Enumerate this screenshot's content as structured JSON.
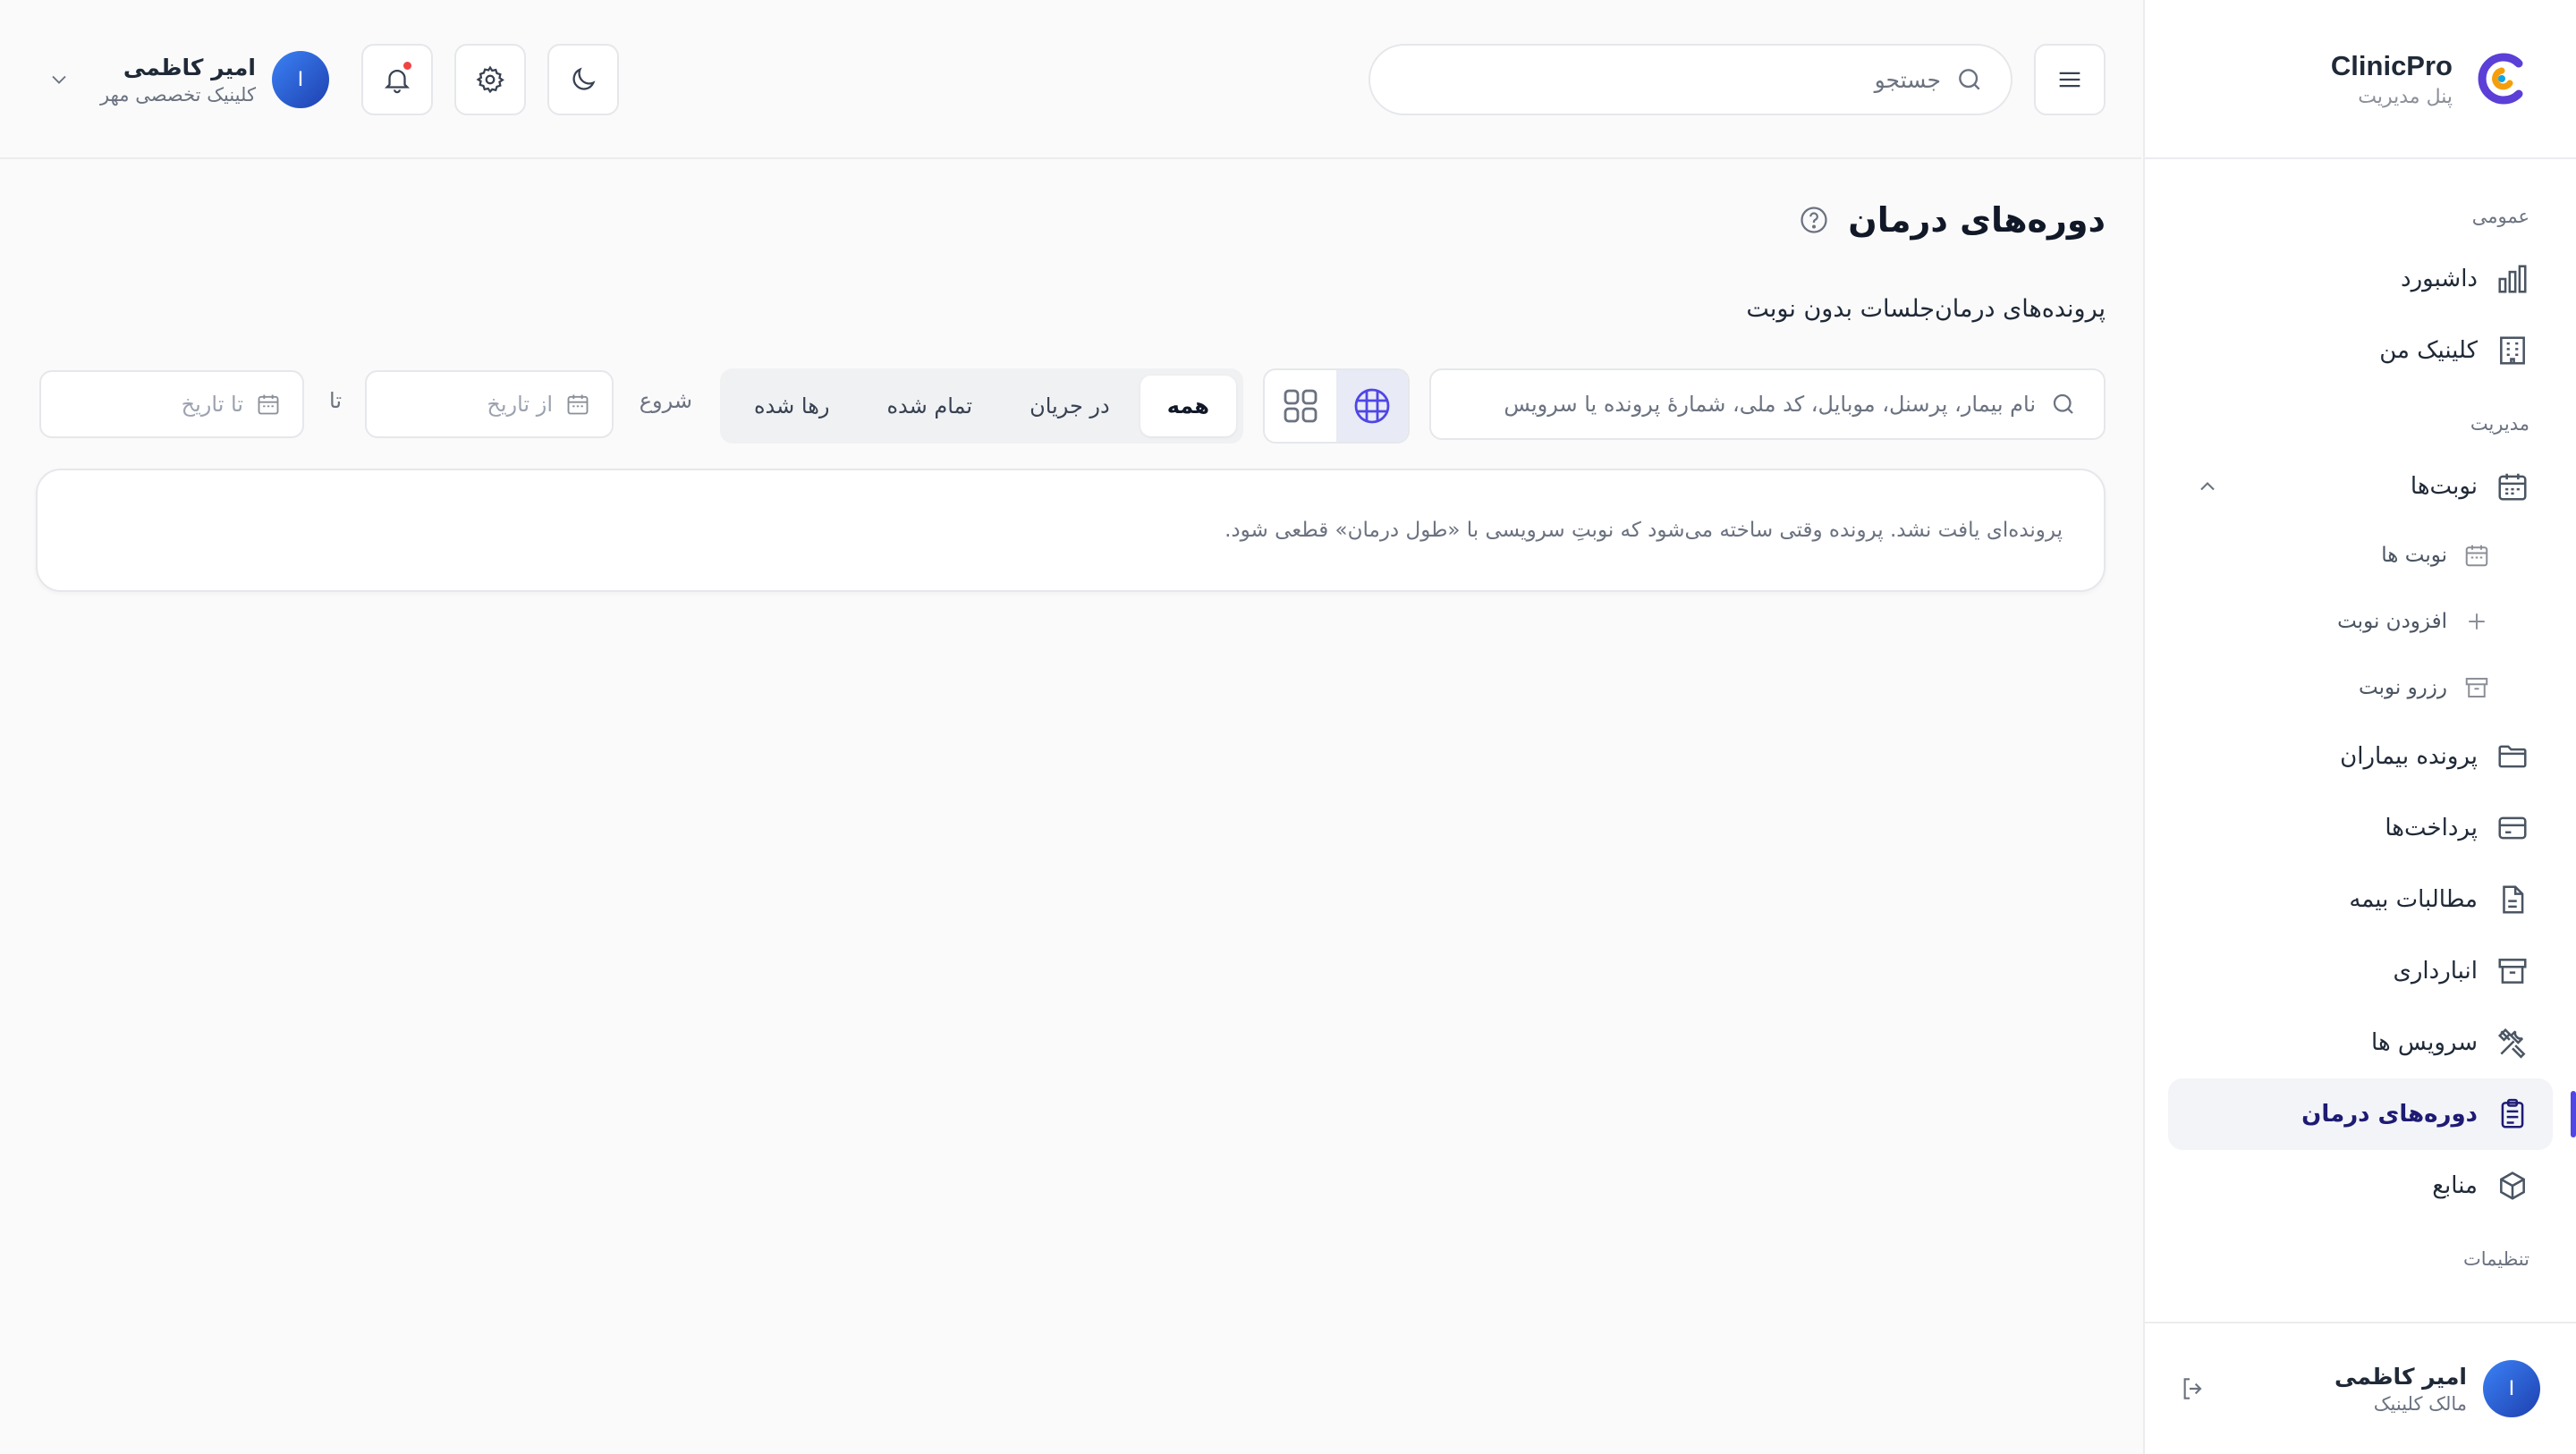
{
  "brand": {
    "name": "ClinicPro",
    "subtitle": "پنل مدیریت"
  },
  "sidebar": {
    "section_general": "عمومی",
    "section_management": "مدیریت",
    "section_settings": "تنظیمات",
    "dashboard": "داشبورد",
    "my_clinic": "کلینیک من",
    "appointments": "نوبت‌ها",
    "appointments_sub": [
      "نوبت ها",
      "افزودن نوبت",
      "رزرو نوبت"
    ],
    "patient_records": "پرونده بیماران",
    "payments": "پرداخت‌ها",
    "insurance_claims": "مطالبات بیمه",
    "inventory": "انبارداری",
    "services": "سرویس ها",
    "treatment_courses": "دوره‌های درمان",
    "resources": "منابع",
    "user": {
      "initial": "I",
      "name": "امیر کاظمی",
      "role": "مالک کلینیک"
    }
  },
  "header": {
    "search_placeholder": "جستجو",
    "user": {
      "initial": "I",
      "name": "امیر کاظمی",
      "clinic": "کلینیک تخصصی مهر"
    }
  },
  "page": {
    "title": "دوره‌های درمان",
    "subtitle": "پرونده‌های درمان‌جلسات بدون نوبت",
    "search_placeholder": "نام بیمار، پرسنل، موبایل، کد ملی، شمارهٔ پرونده یا سرویس",
    "tabs": [
      "همه",
      "در جریان",
      "تمام شده",
      "رها شده"
    ],
    "start_label": "شروع",
    "from_placeholder": "از تاریخ",
    "to_label": "تا",
    "to_placeholder": "تا تاریخ",
    "empty_message": "پرونده‌ای یافت نشد. پرونده وقتی ساخته می‌شود که نوبتِ سرویسی با «طول درمان» قطعی شود."
  },
  "colors": {
    "accent": "#4f46e5",
    "active_bg": "#f3f4f8",
    "active_text": "#1e1b73",
    "notif": "#ef4444"
  }
}
